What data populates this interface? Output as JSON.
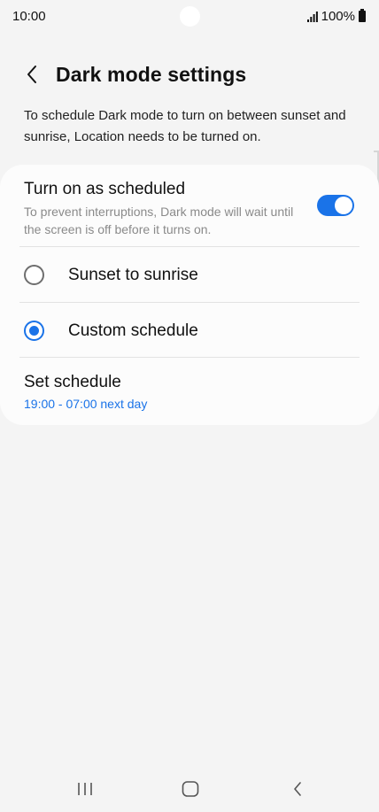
{
  "status_bar": {
    "time": "10:00",
    "battery": "100%"
  },
  "header": {
    "title": "Dark mode settings"
  },
  "description": "To schedule Dark mode to turn on between sunset and sunrise, Location needs to be turned on.",
  "schedule_toggle": {
    "title": "Turn on as scheduled",
    "subtitle": "To prevent interruptions, Dark mode will wait until the screen is off before it turns on.",
    "on": true
  },
  "options": [
    {
      "label": "Sunset to sunrise",
      "selected": false
    },
    {
      "label": "Custom schedule",
      "selected": true
    }
  ],
  "set_schedule": {
    "title": "Set schedule",
    "value": "19:00 - 07:00 next day"
  },
  "colors": {
    "accent": "#1a73e8",
    "background": "#f4f4f4",
    "card": "#fcfcfc"
  },
  "icons": {
    "back": "chevron-left-icon",
    "recents": "recents-icon",
    "home": "home-icon",
    "nav_back": "back-icon"
  }
}
